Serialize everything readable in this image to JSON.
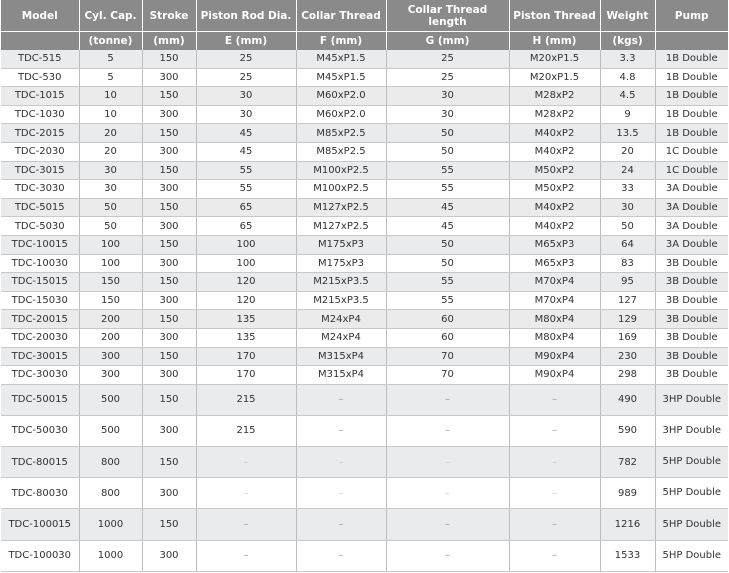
{
  "headers": [
    "Model",
    "Cyl. Cap.",
    "Stroke",
    "Piston Rod Dia.",
    "Collar Thread",
    "Collar Thread length",
    "Piston Thread",
    "Weight",
    "Pump"
  ],
  "units": [
    "",
    "(tonne)",
    "(mm)",
    "E (mm)",
    "F (mm)",
    "G (mm)",
    "H (mm)",
    "(kgs)",
    ""
  ],
  "rows": [
    [
      "TDC-515",
      "5",
      "150",
      "25",
      "M45xP1.5",
      "25",
      "M20xP1.5",
      "3.3",
      "1B Double"
    ],
    [
      "TDC-530",
      "5",
      "300",
      "25",
      "M45xP1.5",
      "25",
      "M20xP1.5",
      "4.8",
      "1B Double"
    ],
    [
      "TDC-1015",
      "10",
      "150",
      "30",
      "M60xP2.0",
      "30",
      "M28xP2",
      "4.5",
      "1B Double"
    ],
    [
      "TDC-1030",
      "10",
      "300",
      "30",
      "M60xP2.0",
      "30",
      "M28xP2",
      "9",
      "1B Double"
    ],
    [
      "TDC-2015",
      "20",
      "150",
      "45",
      "M85xP2.5",
      "50",
      "M40xP2",
      "13.5",
      "1B Double"
    ],
    [
      "TDC-2030",
      "20",
      "300",
      "45",
      "M85xP2.5",
      "50",
      "M40xP2",
      "20",
      "1C Double"
    ],
    [
      "TDC-3015",
      "30",
      "150",
      "55",
      "M100xP2.5",
      "55",
      "M50xP2",
      "24",
      "1C Double"
    ],
    [
      "TDC-3030",
      "30",
      "300",
      "55",
      "M100xP2.5",
      "55",
      "M50xP2",
      "33",
      "3A Double"
    ],
    [
      "TDC-5015",
      "50",
      "150",
      "65",
      "M127xP2.5",
      "45",
      "M40xP2",
      "30",
      "3A Double"
    ],
    [
      "TDC-5030",
      "50",
      "300",
      "65",
      "M127xP2.5",
      "45",
      "M40xP2",
      "50",
      "3A Double"
    ],
    [
      "TDC-10015",
      "100",
      "150",
      "100",
      "M175xP3",
      "50",
      "M65xP3",
      "64",
      "3A Double"
    ],
    [
      "TDC-10030",
      "100",
      "300",
      "100",
      "M175xP3",
      "50",
      "M65xP3",
      "83",
      "3B Double"
    ],
    [
      "TDC-15015",
      "150",
      "150",
      "120",
      "M215xP3.5",
      "55",
      "M70xP4",
      "95",
      "3B Double"
    ],
    [
      "TDC-15030",
      "150",
      "300",
      "120",
      "M215xP3.5",
      "55",
      "M70xP4",
      "127",
      "3B Double"
    ],
    [
      "TDC-20015",
      "200",
      "150",
      "135",
      "M24xP4",
      "60",
      "M80xP4",
      "129",
      "3B Double"
    ],
    [
      "TDC-20030",
      "200",
      "300",
      "135",
      "M24xP4",
      "60",
      "M80xP4",
      "169",
      "3B Double"
    ],
    [
      "TDC-30015",
      "300",
      "150",
      "170",
      "M315xP4",
      "70",
      "M90xP4",
      "230",
      "3B Double"
    ],
    [
      "TDC-30030",
      "300",
      "300",
      "170",
      "M315xP4",
      "70",
      "M90xP4",
      "298",
      "3B Double"
    ],
    [
      "TDC-50015",
      "500",
      "150",
      "215",
      "–",
      "–",
      "–",
      "490",
      "3HP Double"
    ],
    [
      "TDC-50030",
      "500",
      "300",
      "215",
      "–",
      "–",
      "–",
      "590",
      "3HP Double"
    ],
    [
      "TDC-80015",
      "800",
      "150",
      "–",
      "–",
      "–",
      "–",
      "782",
      "5HP Double"
    ],
    [
      "TDC-80030",
      "800",
      "300",
      "–",
      "–",
      "–",
      "–",
      "989",
      "5HP Double"
    ],
    [
      "TDC-100015",
      "1000",
      "150",
      "–",
      "–",
      "–",
      "–",
      "1216",
      "5HP Double"
    ],
    [
      "TDC-100030",
      "1000",
      "300",
      "–",
      "–",
      "–",
      "–",
      "1533",
      "5HP Double"
    ]
  ]
}
